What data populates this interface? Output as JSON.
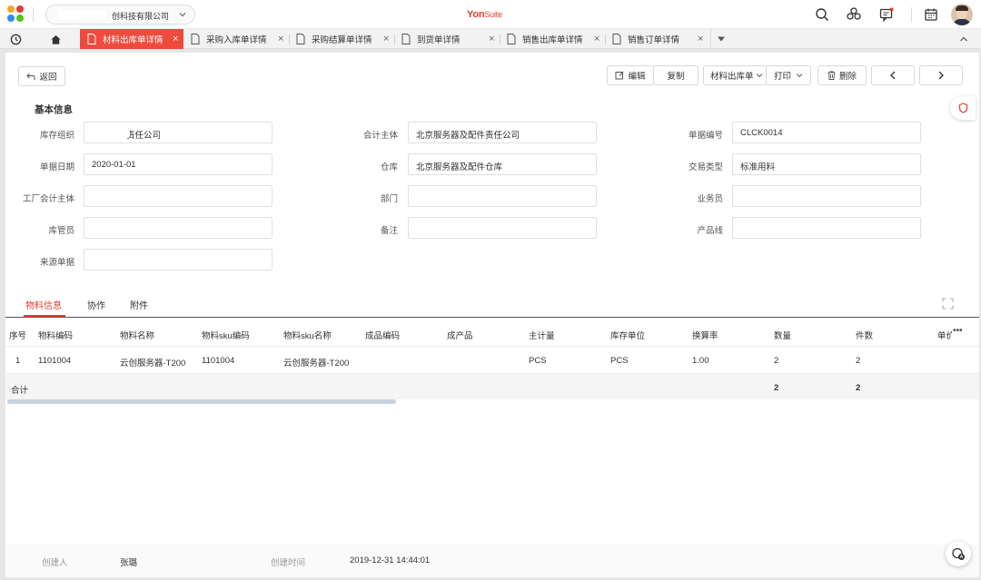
{
  "header": {
    "org_name": "创科技有限公司",
    "brand_main": "Yon",
    "brand_sub": "Suite"
  },
  "tabs": [
    {
      "label": "材料出库单详情",
      "active": true
    },
    {
      "label": "采购入库单详情",
      "active": false
    },
    {
      "label": "采购结算单详情",
      "active": false
    },
    {
      "label": "到货单详情",
      "active": false
    },
    {
      "label": "销售出库单详情",
      "active": false
    },
    {
      "label": "销售订单详情",
      "active": false
    }
  ],
  "toolbar": {
    "back": "返回",
    "edit": "编辑",
    "copy": "复制",
    "material_out": "材料出库单",
    "print": "打印",
    "delete": "删除"
  },
  "section": {
    "basic_info": "基本信息"
  },
  "form": {
    "stock_org": {
      "label": "库存组织",
      "value": "责任公司"
    },
    "accounting_entity": {
      "label": "会计主体",
      "value": "北京服务器及配件责任公司"
    },
    "doc_no": {
      "label": "单据编号",
      "value": "CLCK0014"
    },
    "doc_date": {
      "label": "单据日期",
      "value": "2020-01-01"
    },
    "warehouse": {
      "label": "仓库",
      "value": "北京服务器及配件仓库"
    },
    "trans_type": {
      "label": "交易类型",
      "value": "标准用料"
    },
    "factory_entity": {
      "label": "工厂会计主体",
      "value": ""
    },
    "dept": {
      "label": "部门",
      "value": ""
    },
    "salesman": {
      "label": "业务员",
      "value": ""
    },
    "keeper": {
      "label": "库管员",
      "value": ""
    },
    "remark": {
      "label": "备注",
      "value": ""
    },
    "product_line": {
      "label": "产品线",
      "value": ""
    },
    "source_doc": {
      "label": "来源单据",
      "value": ""
    }
  },
  "subtabs": [
    "物料信息",
    "协作",
    "附件"
  ],
  "table": {
    "headers": [
      "序号",
      "物料编码",
      "物料名称",
      "物料sku编码",
      "物料sku名称",
      "成品编码",
      "成产品",
      "主计量",
      "库存单位",
      "换算率",
      "数量",
      "件数",
      "单价"
    ],
    "rows": [
      [
        "1",
        "1101004",
        "云创服务器-T200",
        "1101004",
        "云创服务器-T200",
        "",
        "",
        "PCS",
        "PCS",
        "1.00",
        "2",
        "2",
        ""
      ]
    ],
    "total_label": "合计",
    "total_qty": "2",
    "total_pieces": "2",
    "more": "•••"
  },
  "footer": {
    "creator_label": "创建人",
    "creator": "张璐",
    "created_label": "创建时间",
    "created_at": "2019-12-31 14:44:01"
  },
  "colors": {
    "accent": "#ee4b3e",
    "brand": "#e23d2d"
  }
}
